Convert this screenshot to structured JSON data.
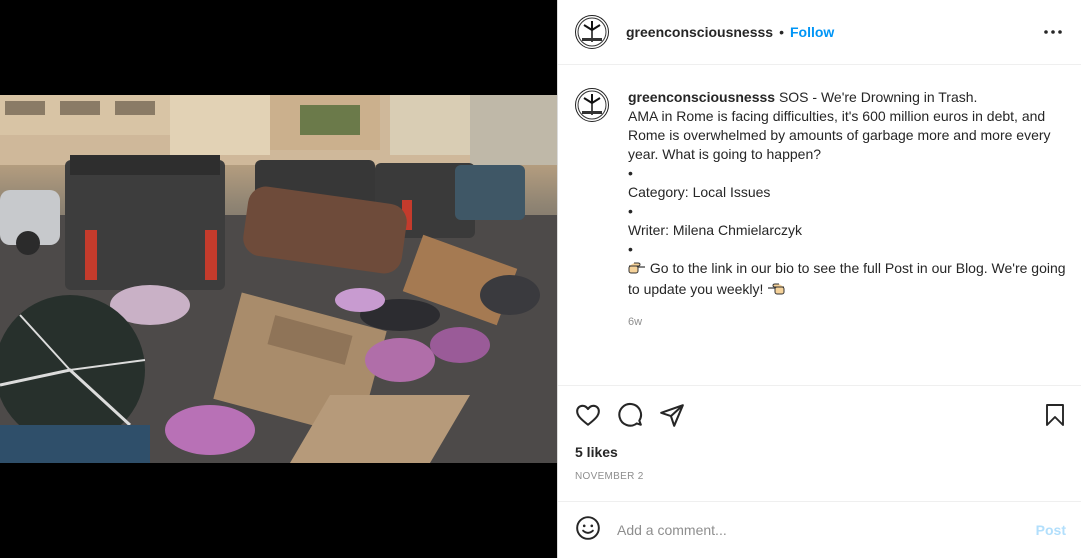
{
  "post": {
    "username": "greenconsciousnesss",
    "follow_label": "Follow",
    "dot": "•",
    "caption": {
      "headline": "SOS - We're Drowning in Trash.",
      "paragraph": "AMA in Rome is facing difficulties, it's 600 million euros in debt, and Rome is overwhelmed by amounts of garbage more and more every year. What is going to happen?",
      "bullet1": "•",
      "category": "Category: Local Issues",
      "bullet2": "•",
      "writer": "Writer: Milena Chmielarczyk",
      "bullet3": "•",
      "cta": "Go to the link in our bio to see the full Post in our Blog. We're going to update you weekly!"
    },
    "time_ago": "6w",
    "likes": "5 likes",
    "date": "NOVEMBER 2"
  },
  "comment": {
    "placeholder": "Add a comment...",
    "post_label": "Post"
  },
  "icons": {
    "more": "more-options-icon",
    "like": "heart-icon",
    "comment": "comment-icon",
    "share": "share-icon",
    "save": "bookmark-icon",
    "emoji": "emoji-icon",
    "pointing": "pointing-hand-icon"
  },
  "colors": {
    "accent": "#0095f6",
    "post_disabled": "#b2dffc",
    "muted": "#8e8e8e"
  }
}
